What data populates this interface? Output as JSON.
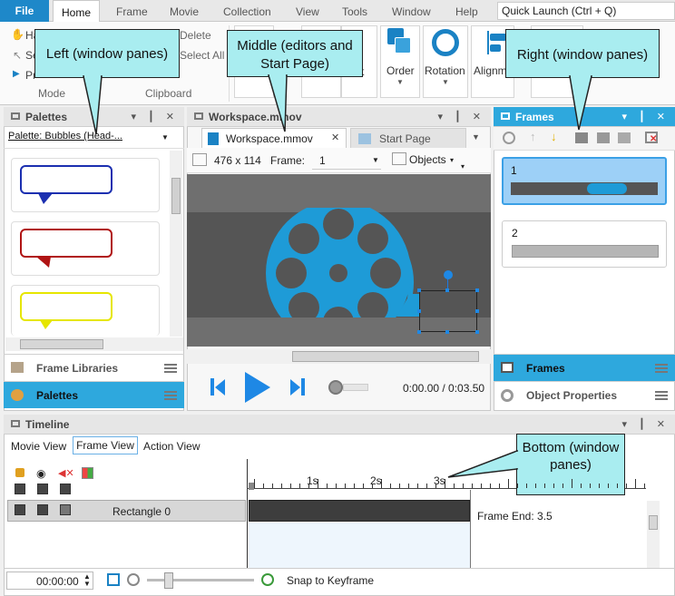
{
  "menu": {
    "file": "File",
    "tabs": [
      "Home",
      "Frame",
      "Movie",
      "Collection",
      "View",
      "Tools",
      "Window",
      "Help"
    ],
    "quick_launch": "Quick Launch (Ctrl + Q)"
  },
  "ribbon": {
    "delete": "Delete",
    "select_all": "Select All",
    "group_mode": "Mode",
    "group_clipboard": "Clipboard",
    "order": "Order",
    "rotation": "Rotation",
    "align": "Alignm",
    "partial_ha": "Ha",
    "partial_se": "Se",
    "partial_pr": "Pr",
    "partial_t": "t"
  },
  "palettes": {
    "title": "Palettes",
    "dropdown": "Palette: Bubbles (Head-...",
    "frame_libraries": "Frame Libraries",
    "palettes_tab": "Palettes",
    "bubble_colors": [
      "#1b2fb0",
      "#b01414",
      "#e6e600"
    ]
  },
  "workspace": {
    "title": "Workspace.mmov",
    "tab_workspace": "Workspace.mmov",
    "tab_start": "Start Page",
    "size": "476 x 114",
    "frame_label": "Frame:",
    "frame_value": "1",
    "objects": "Objects",
    "time": "0:00.00 / 0:03.50"
  },
  "frames": {
    "title": "Frames",
    "items": [
      "1",
      "2"
    ],
    "footer_frames": "Frames",
    "footer_props": "Object Properties"
  },
  "timeline": {
    "title": "Timeline",
    "views": [
      "Movie View",
      "Frame View",
      "Action View"
    ],
    "row_label": "Rectangle 0",
    "frame_end": "Frame End: 3.5",
    "ruler": [
      "1s",
      "2s",
      "3s"
    ],
    "time_input": "00:00:00",
    "snap": "Snap to Keyframe"
  },
  "callouts": {
    "left": "Left (window panes)",
    "middle": "Middle (editors and Start Page)",
    "right": "Right (window panes)",
    "bottom": "Bottom (window panes)"
  },
  "colors": {
    "accent": "#2ea8dd",
    "callout": "#a9edf0",
    "reel": "#1e9bd7"
  }
}
